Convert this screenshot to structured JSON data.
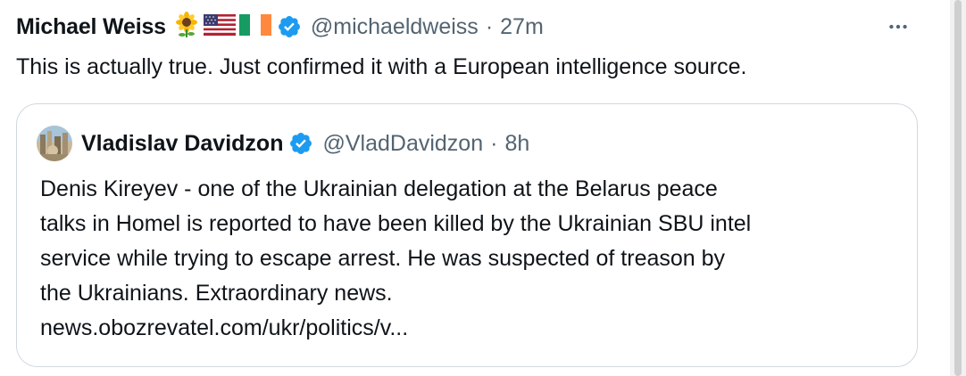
{
  "tweet": {
    "author_name": "Michael Weiss",
    "name_emojis": [
      "sunflower-icon",
      "us-flag-icon",
      "ireland-flag-icon"
    ],
    "handle": "@michaeldweiss",
    "separator": "·",
    "time": "27m",
    "text": "This is actually true. Just confirmed it with a European intelligence source."
  },
  "quoted_tweet": {
    "author_name": "Vladislav Davidzon",
    "handle": "@VladDavidzon",
    "separator": "·",
    "time": "8h",
    "lines": [
      "Denis Kireyev - one of the Ukrainian delegation at the Belarus peace",
      "talks in Homel is reported to have been killed by the Ukrainian SBU intel",
      "service while trying to escape arrest. He was suspected of treason by",
      "the Ukrainians. Extraordinary news."
    ],
    "link": "news.obozrevatel.com/ukr/politics/v..."
  },
  "colors": {
    "text": "#0f1419",
    "secondary": "#536471",
    "verified": "#1d9bf0",
    "border": "#cfd9de"
  }
}
